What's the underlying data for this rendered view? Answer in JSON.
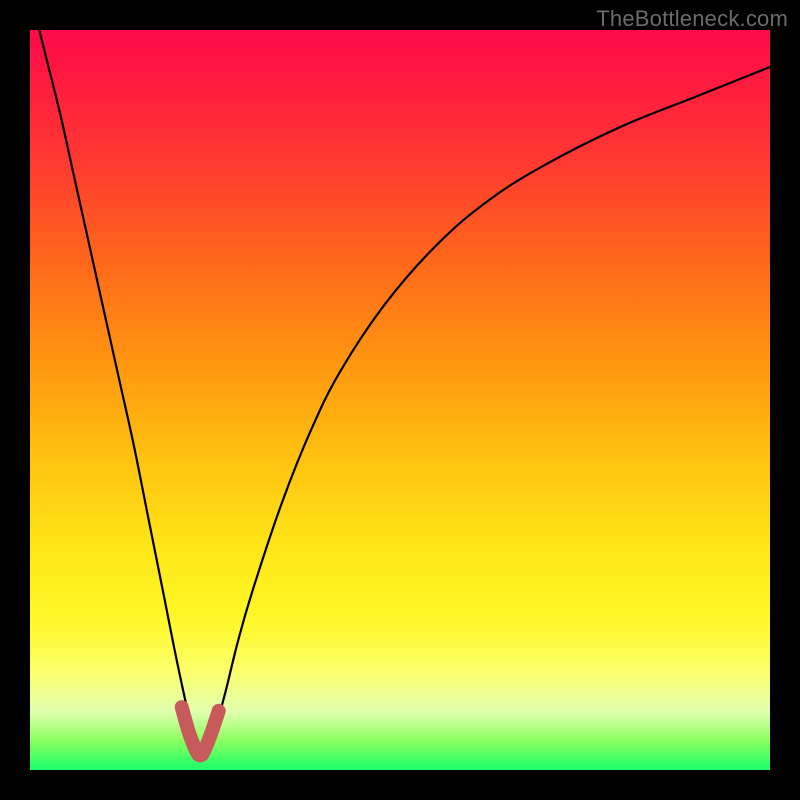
{
  "watermark": "TheBottleneck.com",
  "colors": {
    "background": "#000000",
    "curve": "#000000",
    "valley_marker": "#c75a5a"
  },
  "chart_data": {
    "type": "line",
    "title": "",
    "xlabel": "",
    "ylabel": "",
    "xlim": [
      0,
      100
    ],
    "ylim": [
      0,
      100
    ],
    "grid": false,
    "series": [
      {
        "name": "bottleneck-curve",
        "x": [
          0,
          2,
          4,
          6,
          8,
          10,
          12,
          14,
          16,
          18,
          20,
          22,
          23,
          24,
          26,
          28,
          30,
          34,
          38,
          42,
          48,
          55,
          62,
          70,
          80,
          90,
          100
        ],
        "values": [
          105,
          97,
          89,
          80,
          71,
          62,
          53,
          44,
          34,
          24,
          14,
          5,
          2,
          3,
          9,
          17,
          24,
          36,
          46,
          54,
          63,
          71,
          77,
          82,
          87,
          91,
          95
        ]
      },
      {
        "name": "valley-marker",
        "x": [
          20.5,
          21.5,
          22.5,
          23.0,
          23.5,
          24.5,
          25.5
        ],
        "values": [
          8.5,
          5.0,
          2.5,
          2.0,
          2.5,
          5.0,
          8.0
        ]
      }
    ],
    "annotations": [
      {
        "text": "TheBottleneck.com",
        "position": "top-right"
      }
    ]
  }
}
